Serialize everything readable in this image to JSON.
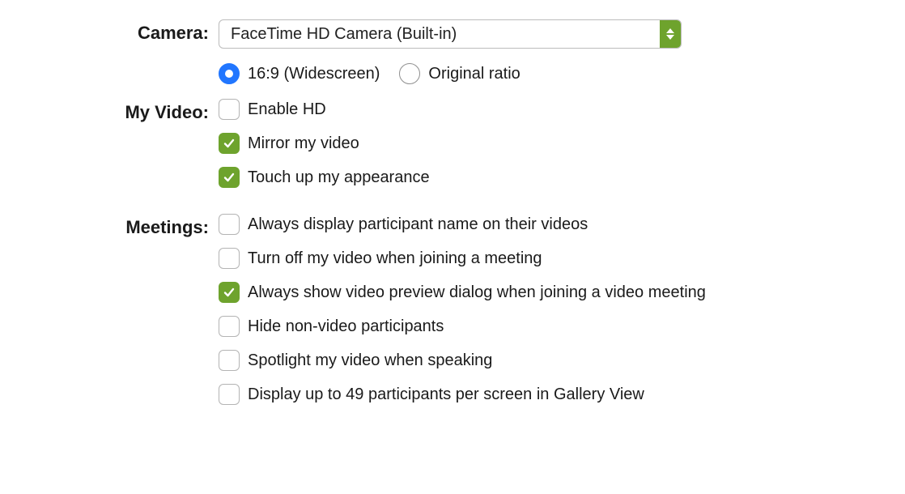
{
  "colors": {
    "accent_green": "#6ea32d",
    "accent_blue": "#2176ff"
  },
  "sections": {
    "camera": {
      "label": "Camera:",
      "selected": "FaceTime HD Camera (Built-in)",
      "ratio": {
        "widescreen_label": "16:9 (Widescreen)",
        "original_label": "Original ratio",
        "selected": "widescreen"
      }
    },
    "my_video": {
      "label": "My Video:",
      "items": [
        {
          "label": "Enable HD",
          "checked": false
        },
        {
          "label": "Mirror my video",
          "checked": true
        },
        {
          "label": "Touch up my appearance",
          "checked": true
        }
      ]
    },
    "meetings": {
      "label": "Meetings:",
      "items": [
        {
          "label": "Always display participant name on their videos",
          "checked": false
        },
        {
          "label": "Turn off my video when joining a meeting",
          "checked": false
        },
        {
          "label": "Always show video preview dialog when joining a video meeting",
          "checked": true
        },
        {
          "label": "Hide non-video participants",
          "checked": false
        },
        {
          "label": "Spotlight my video when speaking",
          "checked": false
        },
        {
          "label": "Display up to 49 participants per screen in Gallery View",
          "checked": false
        }
      ]
    }
  }
}
